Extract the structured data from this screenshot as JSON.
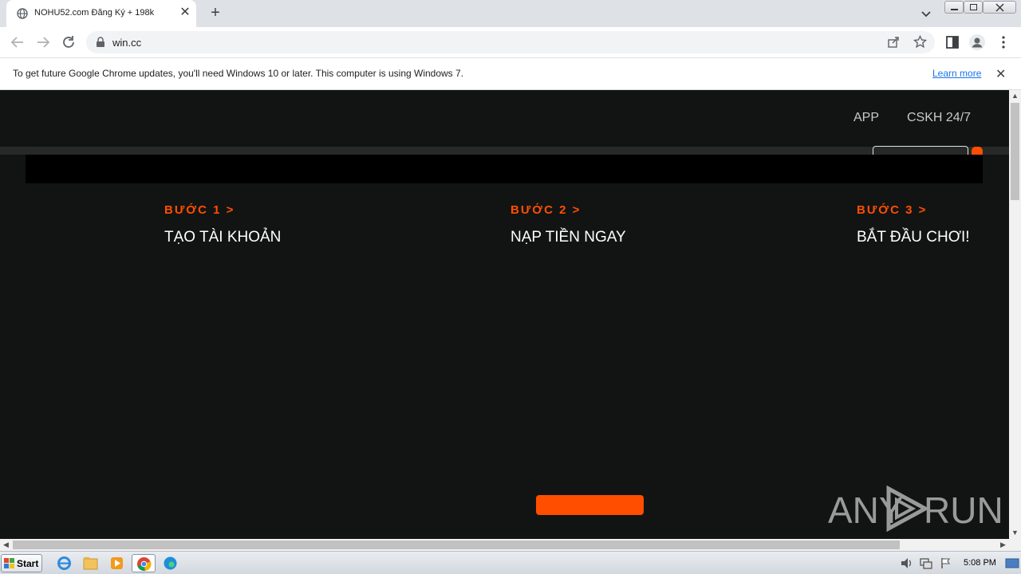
{
  "browser": {
    "tab_title": "NOHU52.com Đăng Ký + 198k",
    "tab_close": "✕",
    "new_tab": "+",
    "url": "win.cc",
    "infobar_text": "To get future Google Chrome updates, you'll need Windows 10 or later. This computer is using Windows 7.",
    "learn_more": "Learn more",
    "infobar_close": "✕"
  },
  "page": {
    "nav": [
      "APP",
      "CSKH 24/7"
    ],
    "steps": [
      {
        "label": "BƯỚC 1 >",
        "title": "TẠO TÀI KHOẢN"
      },
      {
        "label": "BƯỚC 2 >",
        "title": "NẠP TIỀN NGAY"
      },
      {
        "label": "BƯỚC 3 >",
        "title": "BẮT ĐẦU CHƠI!"
      }
    ],
    "accent_color": "#ff4e00",
    "background_color": "#121414"
  },
  "watermark": {
    "text_a": "ANY",
    "text_b": "RUN"
  },
  "taskbar": {
    "start_label": "Start",
    "clock": "5:08 PM"
  }
}
